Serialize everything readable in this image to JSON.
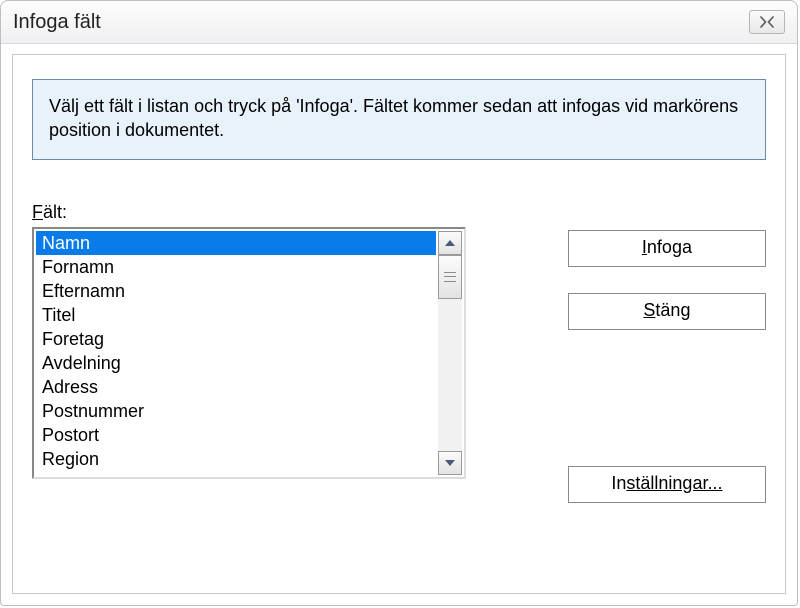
{
  "window": {
    "title": "Infoga fält"
  },
  "info": {
    "text": "Välj ett fält i listan och tryck på 'Infoga'. Fältet kommer sedan att infogas vid markörens position i dokumentet."
  },
  "field": {
    "label_pre": "F",
    "label_post": "ält:"
  },
  "list": {
    "items": [
      "Namn",
      "Fornamn",
      "Efternamn",
      "Titel",
      "Foretag",
      "Avdelning",
      "Adress",
      "Postnummer",
      "Postort",
      "Region"
    ],
    "selected_index": 0
  },
  "buttons": {
    "insert_pre": "I",
    "insert_post": "nfoga",
    "close_pre": "S",
    "close_post": "täng",
    "settings_pre": "In",
    "settings_post": "ställningar..."
  }
}
